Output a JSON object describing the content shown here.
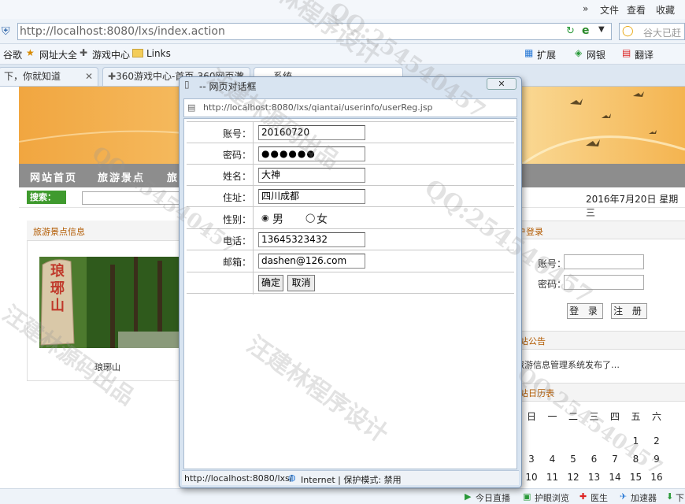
{
  "browser": {
    "menu": {
      "arrows": "»",
      "file": "文件",
      "view": "查看",
      "favorites": "收藏"
    },
    "address": "http://localhost:8080/lxs/index.action",
    "search_placeholder": "谷大已赶",
    "favorites_bar": [
      "谷歌",
      "网址大全",
      "游戏中心",
      "Links"
    ],
    "tools": [
      "扩展",
      "网银",
      "翻译"
    ],
    "tabs": [
      {
        "label": "下，你就知道"
      },
      {
        "label": "360游戏中心-首页-360网页游"
      },
      {
        "label": "系统"
      }
    ],
    "status": {
      "live": "今日直播",
      "eye": "护眼浏览",
      "doctor": "医生",
      "accel": "加速器",
      "down": "下"
    }
  },
  "page": {
    "nav": [
      "网站首页",
      "旅游景点",
      "旅"
    ],
    "search_label": "搜索：",
    "date": "2016年7月20日  星期三",
    "left_title": "旅游景点信息",
    "spot_name": "琅琊山",
    "spot_sign": "琅琊山",
    "login_title": "户登录",
    "account_label": "账号：",
    "password_label": "密码：",
    "login_btn": "登 录",
    "register_btn": "注 册",
    "notice_title": "站公告",
    "notice_text": "旅游信息管理系统发布了…",
    "calendar_title": "站日历表",
    "calendar": {
      "weekdays": [
        "日",
        "一",
        "二",
        "三",
        "四",
        "五",
        "六"
      ],
      "rows": [
        [
          "",
          "",
          "",
          "",
          "",
          "1",
          "2"
        ],
        [
          "3",
          "4",
          "5",
          "6",
          "7",
          "8",
          "9"
        ],
        [
          "10",
          "11",
          "12",
          "13",
          "14",
          "15",
          "16"
        ]
      ]
    }
  },
  "dialog": {
    "title": "-- 网页对话框",
    "close": "✕",
    "url": "http://localhost:8080/lxs/qiantai/userinfo/userReg.jsp",
    "fields": {
      "account": {
        "label": "账号：",
        "value": "20160720"
      },
      "password": {
        "label": "密码：",
        "value": "●●●●●●"
      },
      "name": {
        "label": "姓名：",
        "value": "大神"
      },
      "address": {
        "label": "住址：",
        "value": "四川成都"
      },
      "gender": {
        "label": "性别：",
        "male": "男",
        "female": "女",
        "selected": "male"
      },
      "phone": {
        "label": "电话：",
        "value": "13645323432"
      },
      "email": {
        "label": "邮箱：",
        "value": "dashen@126.com"
      }
    },
    "confirm": "确定",
    "cancel": "取消",
    "status_url": "http://localhost:8080/lxs/",
    "status_zone": "Internet | 保护模式: 禁用"
  },
  "watermark": {
    "line1": "汪建林程序设计",
    "line2": "QQ:254540457",
    "line3": "汪建林源码出品"
  },
  "colors": {
    "nav_bg": "#8d8d8d",
    "title_orange": "#b25a00",
    "search_green": "#3f9a2e"
  }
}
